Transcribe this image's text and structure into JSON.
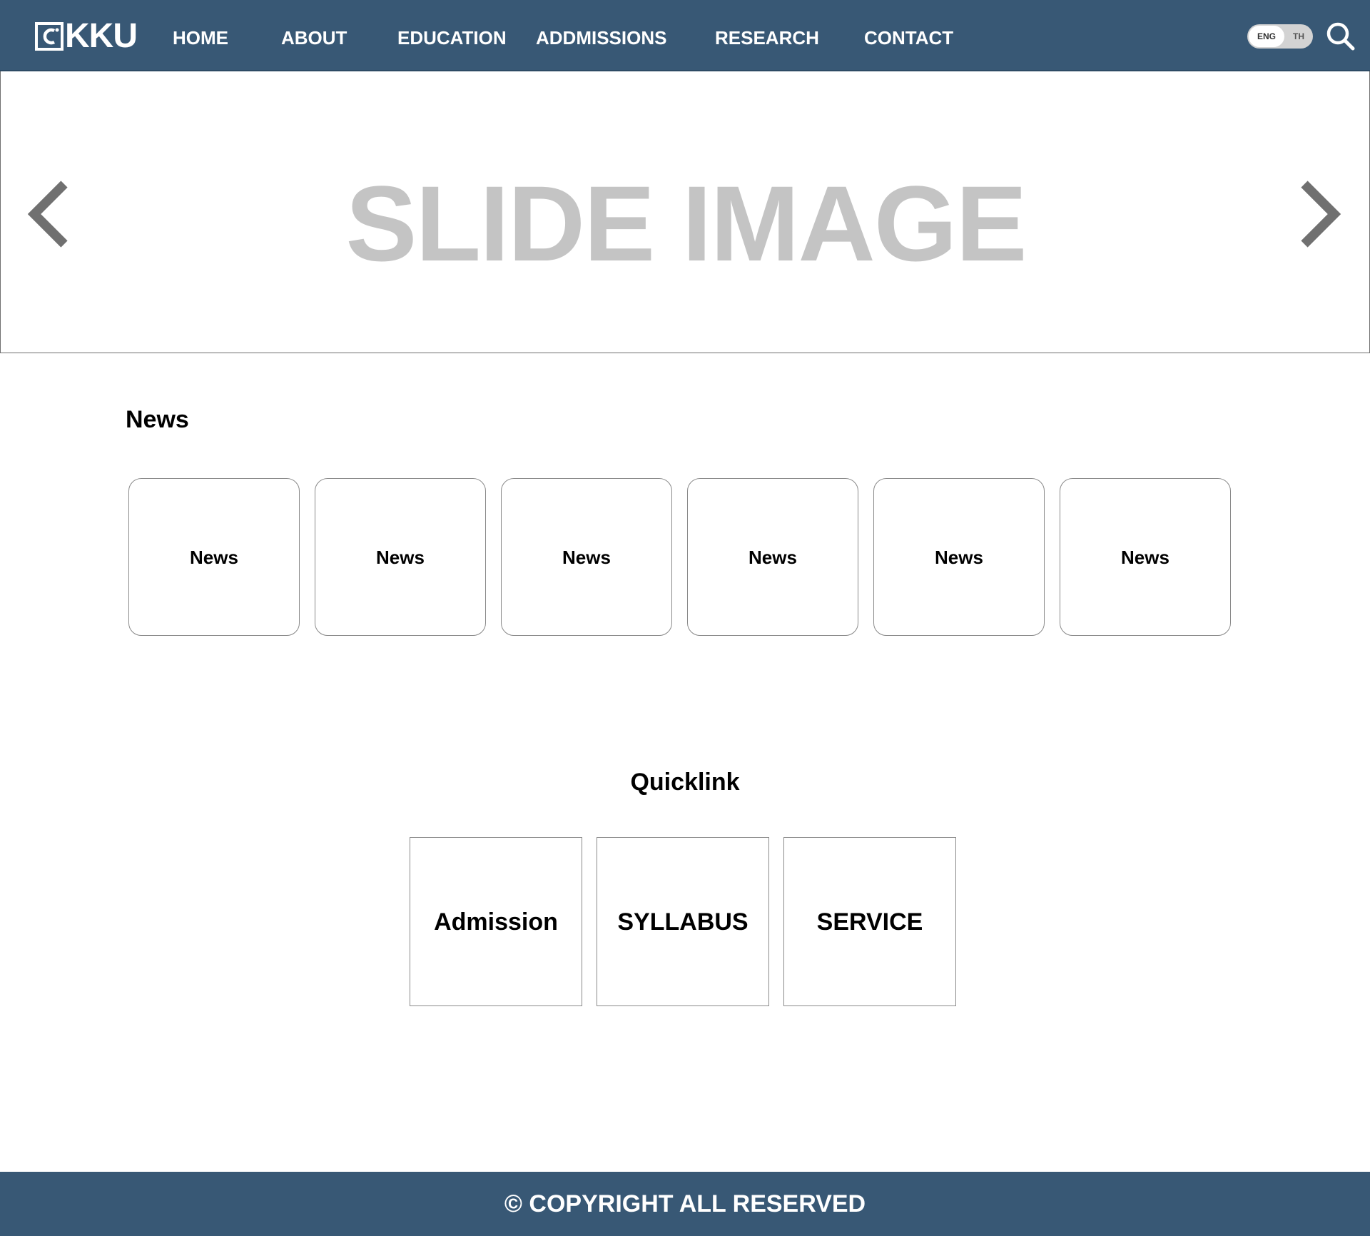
{
  "header": {
    "logo_text": "KKU",
    "logo_icon": "kku-logo-icon",
    "nav": [
      {
        "label": "HOME"
      },
      {
        "label": "ABOUT"
      },
      {
        "label": "EDUCATION"
      },
      {
        "label": "ADDMISSIONS"
      },
      {
        "label": "RESEARCH"
      },
      {
        "label": "CONTACT"
      }
    ],
    "language": {
      "active": "ENG",
      "options": [
        "ENG",
        "TH"
      ]
    },
    "search_icon": "search-icon",
    "background_color": "#385875"
  },
  "slider": {
    "text": "SLIDE IMAGE",
    "prev_icon": "chevron-left-icon",
    "next_icon": "chevron-right-icon"
  },
  "news": {
    "title": "News",
    "items": [
      {
        "label": "News"
      },
      {
        "label": "News"
      },
      {
        "label": "News"
      },
      {
        "label": "News"
      },
      {
        "label": "News"
      },
      {
        "label": "News"
      }
    ]
  },
  "quicklink": {
    "title": "Quicklink",
    "items": [
      {
        "label": "Admission"
      },
      {
        "label": "SYLLABUS"
      },
      {
        "label": "SERVICE"
      }
    ]
  },
  "footer": {
    "text": "© COPYRIGHT ALL RESERVED",
    "background_color": "#385875"
  }
}
